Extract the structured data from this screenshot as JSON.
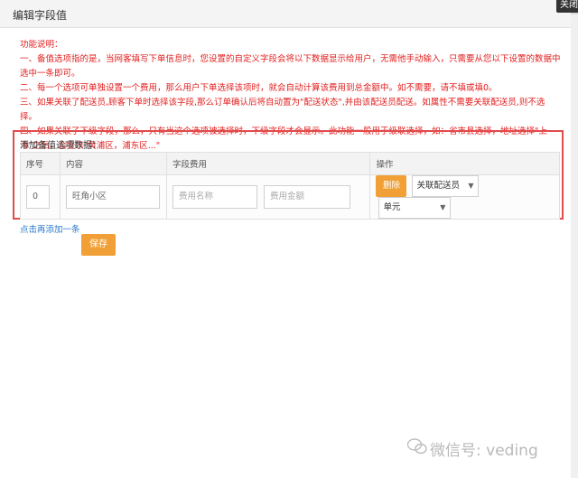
{
  "dialog": {
    "title": "编辑字段值",
    "close_label": "关闭"
  },
  "notes": {
    "heading": "功能说明：",
    "lines": [
      "一、备值选项指的是，当网客填写下单信息时，您设置的自定义字段会将以下数据显示给用户，无需他手动输入，只需要从您以下设置的数据中选中一条即可。",
      "二、每一个选项可单独设置一个费用，那么用户下单选择该项时，就会自动计算该费用到总金额中。如不需要，请不填或填0。",
      "三、如果关联了配送员,顾客下单时选择该字段,那么订单确认后将自动置为\"配送状态\",并由该配送员配送。如属性不需要关联配送员,则不选择。",
      "四、如果关联了下级字段，那么，只有当这个选项被选择时，下级字段才会显示。此功能一般用于级联选择，如：省市县选择，地址选择\"上海\"之后，会显示\"黄浦区，浦东区...\""
    ]
  },
  "section_label": "添加备值选项数据：",
  "table": {
    "headers": [
      "序号",
      "内容",
      "字段费用",
      "操作"
    ],
    "row": {
      "index_value": "0",
      "content_value": "旺角小区",
      "fee_name_placeholder": "费用名称",
      "fee_amount_placeholder": "费用金额",
      "delete_label": "删除",
      "courier_select": "关联配送员",
      "unit_select": "单元"
    }
  },
  "add_link": "点击再添加一条",
  "save_label": "保存",
  "watermark": "微信号: veding"
}
